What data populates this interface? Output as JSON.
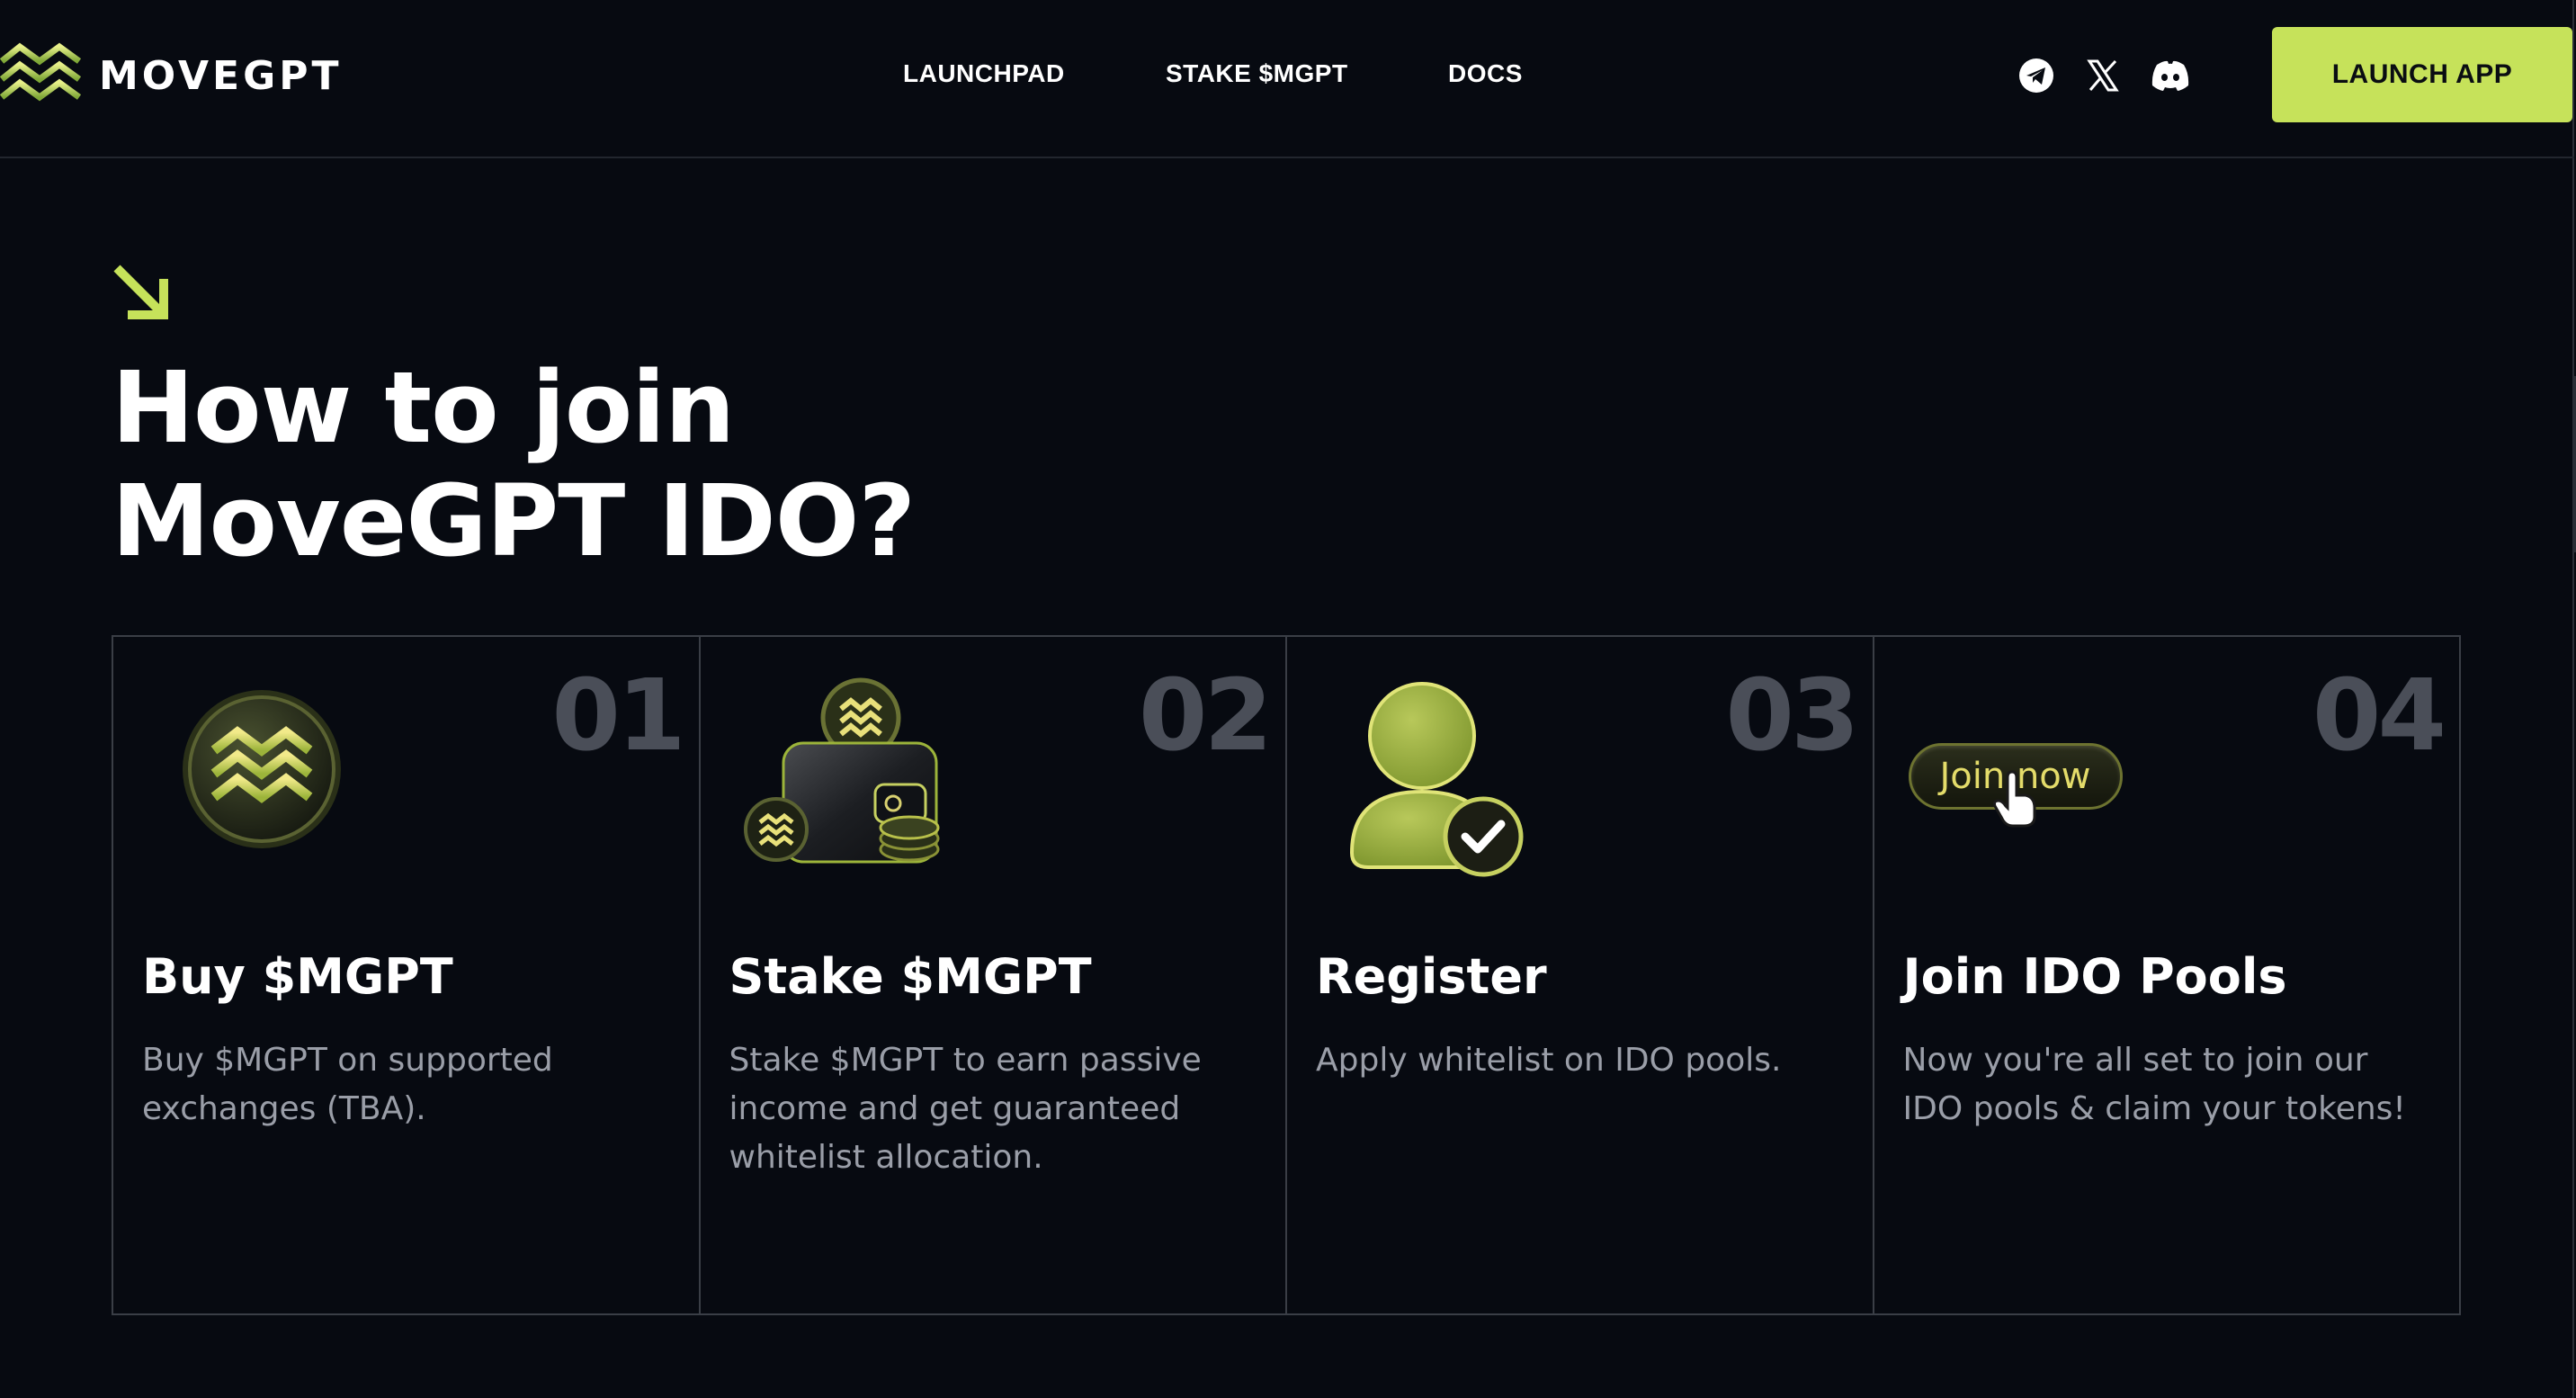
{
  "brand": {
    "name": "MOVEGPT",
    "logo_icon": "wave-logo-icon",
    "accent_color": "#c6e25a"
  },
  "nav": {
    "items": [
      "LAUNCHPAD",
      "STAKE $MGPT",
      "DOCS"
    ]
  },
  "social": {
    "icons": [
      "telegram-icon",
      "x-icon",
      "discord-icon"
    ]
  },
  "header": {
    "launch_label": "LAUNCH APP"
  },
  "section": {
    "arrow_icon": "arrow-down-right-icon",
    "title_line1": "How to join",
    "title_line2": "MoveGPT IDO?"
  },
  "steps": [
    {
      "number": "01",
      "title": "Buy $MGPT",
      "description": "Buy $MGPT on supported exchanges (TBA).",
      "icon": "mgpt-coin-icon"
    },
    {
      "number": "02",
      "title": "Stake $MGPT",
      "description": "Stake $MGPT to earn passive income and get guaranteed whitelist allocation.",
      "icon": "wallet-coins-icon"
    },
    {
      "number": "03",
      "title": "Register",
      "description": "Apply whitelist on IDO pools.",
      "icon": "user-check-icon"
    },
    {
      "number": "04",
      "title": "Join IDO Pools",
      "description": "Now you're all set to join our IDO pools & claim your tokens!",
      "icon": "join-now-button-icon",
      "pill_label": "Join now"
    }
  ]
}
